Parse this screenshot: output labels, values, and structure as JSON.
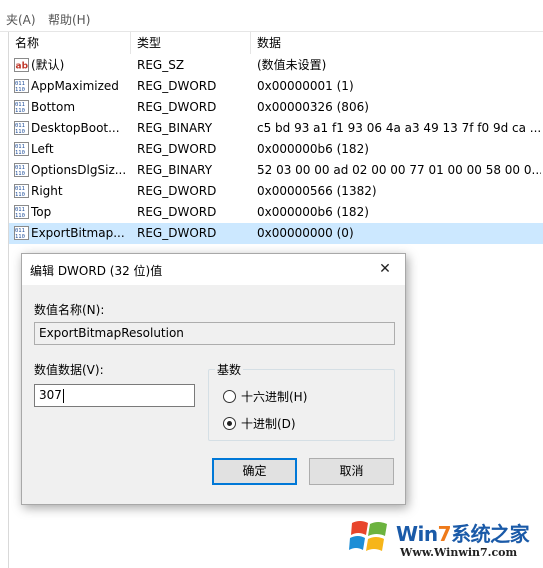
{
  "menubar": {
    "items": [
      {
        "label": "夹(A)"
      },
      {
        "label": "帮助(H)"
      }
    ]
  },
  "columns": {
    "name": "名称",
    "type": "类型",
    "data": "数据"
  },
  "rows": [
    {
      "icon": "string-value-icon",
      "name": "(默认)",
      "type": "REG_SZ",
      "data": "(数值未设置)"
    },
    {
      "icon": "binary-value-icon",
      "name": "AppMaximized",
      "type": "REG_DWORD",
      "data": "0x00000001 (1)"
    },
    {
      "icon": "binary-value-icon",
      "name": "Bottom",
      "type": "REG_DWORD",
      "data": "0x00000326 (806)"
    },
    {
      "icon": "binary-value-icon",
      "name": "DesktopBoot...",
      "type": "REG_BINARY",
      "data": "c5 bd 93 a1 f1 93 06 4a a3 49 13 7f f0 9d ca ..."
    },
    {
      "icon": "binary-value-icon",
      "name": "Left",
      "type": "REG_DWORD",
      "data": "0x000000b6 (182)"
    },
    {
      "icon": "binary-value-icon",
      "name": "OptionsDlgSiz...",
      "type": "REG_BINARY",
      "data": "52 03 00 00 ad 02 00 00 77 01 00 00 58 00 0..."
    },
    {
      "icon": "binary-value-icon",
      "name": "Right",
      "type": "REG_DWORD",
      "data": "0x00000566 (1382)"
    },
    {
      "icon": "binary-value-icon",
      "name": "Top",
      "type": "REG_DWORD",
      "data": "0x000000b6 (182)"
    },
    {
      "icon": "binary-value-icon",
      "name": "ExportBitmap...",
      "type": "REG_DWORD",
      "data": "0x00000000 (0)",
      "selected": true
    }
  ],
  "dialog": {
    "title": "编辑 DWORD (32 位)值",
    "close_glyph": "✕",
    "value_name_label": "数值名称(N):",
    "value_name": "ExportBitmapResolution",
    "value_data_label": "数值数据(V):",
    "value_data": "307",
    "base_label": "基数",
    "base_options": [
      {
        "label": "十六进制(H)",
        "checked": false
      },
      {
        "label": "十进制(D)",
        "checked": true
      }
    ],
    "ok_label": "确定",
    "cancel_label": "取消"
  },
  "watermark": {
    "brand_prefix": "Win",
    "brand_seven": "7",
    "brand_suffix": "系统之家",
    "url": "Www.Winwin7.com"
  },
  "colors": {
    "selection": "#cce8ff",
    "default_button_border": "#0078d7",
    "dialog_bg": "#f0f0f0"
  }
}
